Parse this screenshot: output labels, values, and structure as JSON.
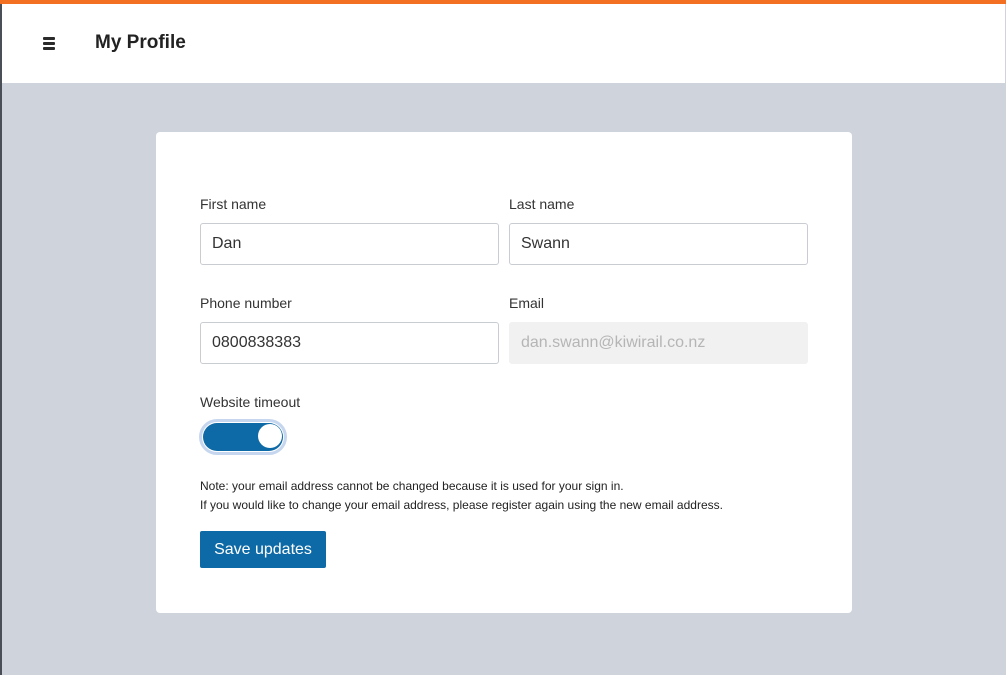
{
  "header": {
    "title": "My Profile",
    "menu_icon": "hamburger-menu-icon"
  },
  "colors": {
    "accent": "#f36f21",
    "primary": "#0e6aa6",
    "background": "#ced3dc"
  },
  "form": {
    "first_name": {
      "label": "First name",
      "value": "Dan"
    },
    "last_name": {
      "label": "Last name",
      "value": "Swann"
    },
    "phone": {
      "label": "Phone number",
      "value": "0800838383"
    },
    "email": {
      "label": "Email",
      "value": "dan.swann@kiwirail.co.nz",
      "disabled": true
    },
    "website_timeout": {
      "label": "Website timeout",
      "enabled": true
    }
  },
  "note": {
    "line1": "Note: your email address cannot be changed because it is used for your sign in.",
    "line2": "If you would like to change your email address, please register again using the new email address."
  },
  "actions": {
    "save_label": "Save updates"
  }
}
